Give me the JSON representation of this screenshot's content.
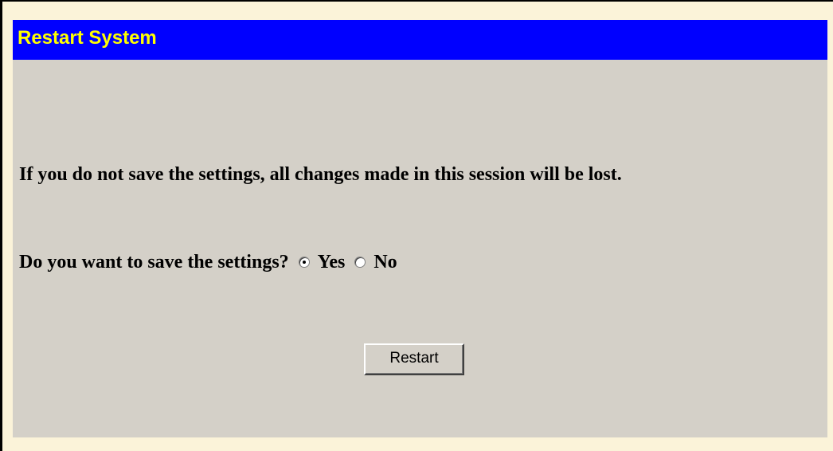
{
  "title": "Restart System",
  "message": "If you do not save the settings, all changes made in this session will be lost.",
  "question": "Do you want to save the settings?",
  "options": [
    {
      "label": "Yes",
      "checked": true
    },
    {
      "label": "No",
      "checked": false
    }
  ],
  "button_label": "Restart",
  "colors": {
    "title_bar": "#0000ff",
    "title_text": "#ffff00",
    "panel": "#d4d0c8",
    "background": "#fbf3d9"
  }
}
